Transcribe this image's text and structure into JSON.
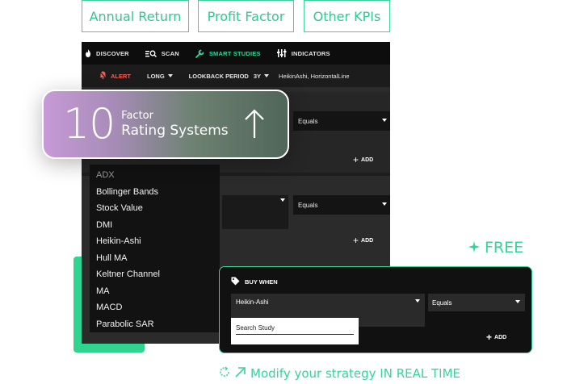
{
  "kpi_tabs": [
    "Annual Return",
    "Profit Factor",
    "Other KPIs"
  ],
  "nav": {
    "items": [
      {
        "label": "DISCOVER",
        "icon": "flame-icon"
      },
      {
        "label": "SCAN",
        "icon": "scan-icon"
      },
      {
        "label": "SMART STUDIES",
        "icon": "wrench-icon"
      },
      {
        "label": "INDICATORS",
        "icon": "indicators-icon"
      }
    ],
    "active": "SMART STUDIES"
  },
  "toolbar": {
    "alert_label": "ALERT",
    "direction": "LONG",
    "lookback_label": "LOOKBACK PERIOD",
    "lookback_value": "3Y",
    "studies": "HeikinAshi, HorizontalLine"
  },
  "panels": {
    "equals_label": "Equals",
    "add_label": "ADD"
  },
  "study_list": {
    "items": [
      "ADX",
      "Bollinger Bands",
      "Stock Value",
      "DMI",
      "Heikin-Ashi",
      "Hull MA",
      "Keltner Channel",
      "MA",
      "MACD",
      "Parabolic SAR"
    ]
  },
  "rating_card": {
    "number": "10",
    "line1": "Factor",
    "line2": "Rating Systems"
  },
  "free_badge": "FREE",
  "buy_card": {
    "title": "BUY WHEN",
    "selected_study": "Heikin-Ashi",
    "operator": "Equals",
    "search_placeholder": "Search Study",
    "add_label": "ADD"
  },
  "bottom_cta": "Modify your strategy IN REAL TIME",
  "colors": {
    "accent_green": "#35d49a",
    "alert_red": "#ff5a52",
    "dark_bg": "#2b2b2b"
  }
}
